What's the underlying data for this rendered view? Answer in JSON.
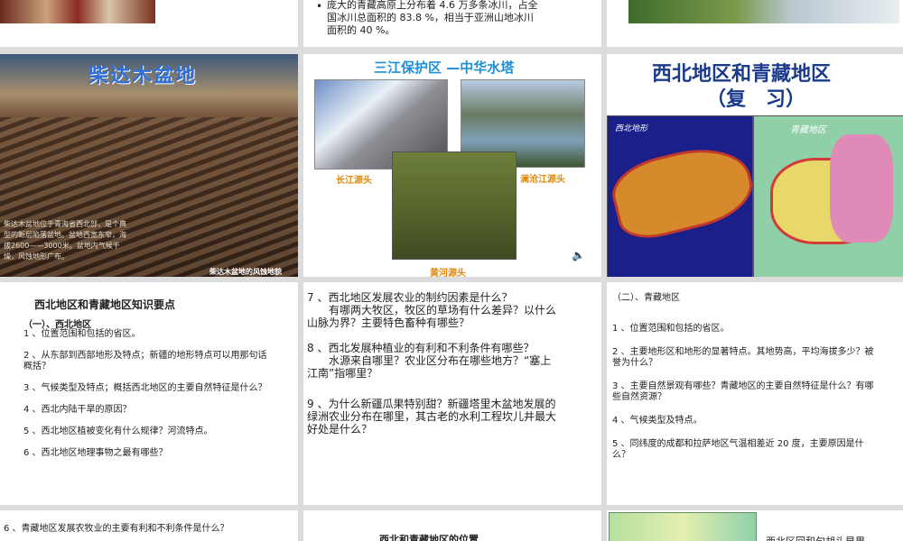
{
  "slide_a": {
    "bullet": "•",
    "text": "庞大的青藏高原上分布着 4.6 万多条冰川，占全国冰川总面积的 83.8 %，相当于亚洲山地冰川面积的 40 %。"
  },
  "slide_qaidam": {
    "title": "柴达木盆地",
    "caption": "柴达木盆地位于青海省西北部，是个典型的断层陷落盆地。盆地西宽东窄，海拔2600——3000米。盆地内气候干燥，风蚀地形广布。",
    "footer": "柴达木盆地的风蚀地貌"
  },
  "slide_sanjiang": {
    "title": "三江保护区 —中华水塔",
    "label_yangtze": "长江源头",
    "label_lancang": "澜沧江源头",
    "label_yellow": "黄河源头"
  },
  "slide_title": {
    "line1": "西北地区和青藏地区",
    "line2": "（复　习）",
    "map_left_label": "西北地形",
    "map_right_label": "青藏地区"
  },
  "slide_nw": {
    "heading": "西北地区和青藏地区知识要点",
    "section": "（一）、西北地区",
    "items": [
      "1 、位置范围和包括的省区。",
      "2 、从东部到西部地形及特点；新疆的地形特点可以用那句话概括？",
      "3 、气候类型及特点；概括西北地区的主要自然特征是什么？",
      "4 、西北内陆干旱的原因？",
      "5 、西北地区植被变化有什么规律？河流特点。",
      "6 、西北地区地理事物之最有哪些？"
    ]
  },
  "slide_q": {
    "q7": "7 、西北地区发展农业的制约因素是什么？",
    "q7b": "有哪两大牧区，牧区的草场有什么差异？以什么山脉为界？主要特色畜种有哪些？",
    "q8": "8 、西北发展种植业的有利和不利条件有哪些？",
    "q8b": "水源来自哪里？农业区分布在哪些地方？“塞上江南”指哪里？",
    "q9": "9 、为什么新疆瓜果特别甜？新疆塔里木盆地发展的绿洲农业分布在哪里，其古老的水利工程坎儿井最大好处是什么？"
  },
  "slide_qt": {
    "section": "（二）、青藏地区",
    "items": [
      "1 、位置范围和包括的省区。",
      "2 、主要地形区和地形的显著特点。其地势高，平均海拔多少？被誉为什么？",
      "3 、主要自然景观有哪些？青藏地区的主要自然特征是什么？有哪些自然资源？",
      "4 、气候类型及特点。",
      "5 、同纬度的成都和拉萨地区气温相差近 20 度，主要原因是什么？"
    ]
  },
  "slide_b1": {
    "text": "6 、青藏地区发展农牧业的主要有利和不利条件是什么？"
  },
  "slide_b2": {
    "text": "西北和青藏地区的位置"
  },
  "slide_b3": {
    "text": "西北区回和句胡头早里"
  },
  "colors": {
    "title_blue": "#1a3a8c",
    "caption_orange": "#e08a10",
    "panel_gray": "#dcdcdc"
  }
}
